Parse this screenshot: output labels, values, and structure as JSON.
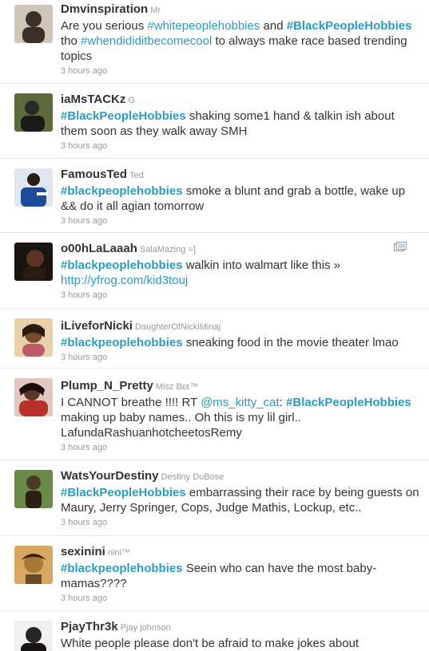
{
  "tweets": [
    {
      "screen_name": "Dmvinspiration",
      "full_name": "Mr",
      "segments": [
        {
          "t": "Are you serious "
        },
        {
          "t": "#whitepeoplehobbies",
          "k": "ht"
        },
        {
          "t": " and "
        },
        {
          "t": "#BlackPeopleHobbies",
          "k": "htb"
        },
        {
          "t": " tho "
        },
        {
          "t": "#whendididitbecomecool",
          "k": "ht"
        },
        {
          "t": " to always make race based trending topics"
        }
      ],
      "time": "3 hours ago",
      "avatar_color": "#3a3028"
    },
    {
      "screen_name": "iaMsTACKz",
      "full_name": "G",
      "segments": [
        {
          "t": "#BlackPeopleHobbies",
          "k": "htb"
        },
        {
          "t": " shaking some1 hand & talkin ish about them soon as they walk away SMH"
        }
      ],
      "time": "3 hours ago",
      "avatar_color": "#2a2a24"
    },
    {
      "screen_name": "FamousTed",
      "full_name": "Ted",
      "segments": [
        {
          "t": "#blackpeoplehobbies",
          "k": "htb"
        },
        {
          "t": " smoke a blunt and grab a bottle, wake up && do it all agian tomorrow"
        }
      ],
      "time": "3 hours ago",
      "avatar_color": "#1e4a9a"
    },
    {
      "screen_name": "o00hLaLaaah",
      "full_name": "SalaMazing =]",
      "segments": [
        {
          "t": "#blackpeoplehobbies",
          "k": "htb"
        },
        {
          "t": " walkin into walmart like this » "
        },
        {
          "t": "http://yfrog.com/kid3touj",
          "k": "url"
        }
      ],
      "time": "3 hours ago",
      "avatar_color": "#3a2418",
      "media_icon": "photo-icon"
    },
    {
      "screen_name": "iLiveforNicki",
      "full_name": "DaughterOfNickiMinaj",
      "segments": [
        {
          "t": "#blackpeoplehobbies",
          "k": "htb"
        },
        {
          "t": " sneaking food in the movie theater lmao"
        }
      ],
      "time": "3 hours ago",
      "avatar_color": "#7a4a2a"
    },
    {
      "screen_name": "Plump_N_Pretty",
      "full_name": "Misz Bεε™",
      "segments": [
        {
          "t": "I CANNOT breathe !!!! RT "
        },
        {
          "t": "@ms_kitty_cat",
          "k": "mention"
        },
        {
          "t": ": "
        },
        {
          "t": "#BlackPeopleHobbies",
          "k": "htb"
        },
        {
          "t": " making up baby names.. Oh this is my lil girl.. LafundaRashuanhotcheetosRemy"
        }
      ],
      "time": "3 hours ago",
      "avatar_color": "#b8322a"
    },
    {
      "screen_name": "WatsYourDestiny",
      "full_name": "Destiny DuBose",
      "segments": [
        {
          "t": "#BlackPeopleHobbies",
          "k": "htb"
        },
        {
          "t": " embarrassing their race by being guests on Maury, Jerry Springer, Cops, Judge Mathis, Lockup, etc.."
        }
      ],
      "time": "3 hours ago",
      "avatar_color": "#4a3a2a"
    },
    {
      "screen_name": "sexinini",
      "full_name": "nini™",
      "segments": [
        {
          "t": "#blackpeoplehobbies",
          "k": "htb"
        },
        {
          "t": " Seein who can have the most baby-mamas????"
        }
      ],
      "time": "3 hours ago",
      "avatar_color": "#a87838"
    },
    {
      "screen_name": "PjayThr3k",
      "full_name": "Pjay johnson",
      "segments": [
        {
          "t": "White people please don't be afraid to make jokes about"
        }
      ],
      "time": "",
      "avatar_color": "#2a2420"
    }
  ]
}
